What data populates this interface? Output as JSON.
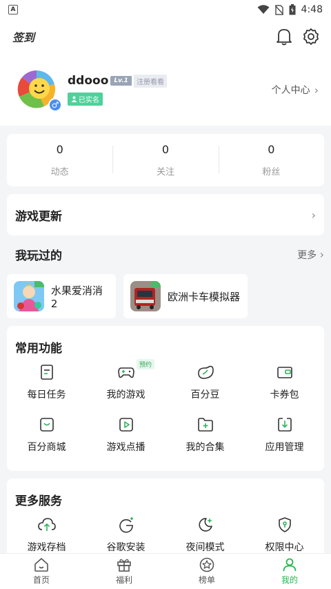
{
  "status_bar": {
    "left_icon": "A",
    "time": "4:48"
  },
  "top_bar": {
    "signin_label": "签到",
    "bell_icon": "bell-icon",
    "settings_icon": "gear-icon"
  },
  "profile": {
    "username": "ddooo",
    "level": "Lv.1",
    "level_text": "注册看看",
    "verified": "已实名",
    "gender": "♂",
    "center_link": "个人中心"
  },
  "stats": [
    {
      "value": "0",
      "label": "动态"
    },
    {
      "value": "0",
      "label": "关注"
    },
    {
      "value": "0",
      "label": "粉丝"
    }
  ],
  "game_update": {
    "title": "游戏更新"
  },
  "played": {
    "title": "我玩过的",
    "more": "更多",
    "games": [
      {
        "name": "水果爱消消2"
      },
      {
        "name": "欧洲卡车模拟器"
      }
    ]
  },
  "common": {
    "title": "常用功能",
    "items": [
      {
        "label": "每日任务",
        "icon": "task-icon"
      },
      {
        "label": "我的游戏",
        "icon": "gamepad-icon",
        "badge": "预约"
      },
      {
        "label": "百分豆",
        "icon": "bean-icon"
      },
      {
        "label": "卡券包",
        "icon": "wallet-icon"
      },
      {
        "label": "百分商城",
        "icon": "shop-icon"
      },
      {
        "label": "游戏点播",
        "icon": "play-icon"
      },
      {
        "label": "我的合集",
        "icon": "folder-icon"
      },
      {
        "label": "应用管理",
        "icon": "download-icon"
      }
    ]
  },
  "more_services": {
    "title": "更多服务",
    "items": [
      {
        "label": "游戏存档",
        "icon": "cloud-upload-icon"
      },
      {
        "label": "谷歌安装",
        "icon": "google-icon"
      },
      {
        "label": "夜间模式",
        "icon": "moon-icon"
      },
      {
        "label": "权限中心",
        "icon": "shield-icon"
      }
    ]
  },
  "tabs": [
    {
      "label": "首页",
      "icon": "home-icon",
      "active": false
    },
    {
      "label": "福利",
      "icon": "gift-icon",
      "active": false
    },
    {
      "label": "榜单",
      "icon": "star-icon",
      "active": false
    },
    {
      "label": "我的",
      "icon": "person-icon",
      "active": true
    }
  ],
  "colors": {
    "accent": "#27b84f",
    "verified": "#4fd19a",
    "gender": "#4a8df0"
  }
}
